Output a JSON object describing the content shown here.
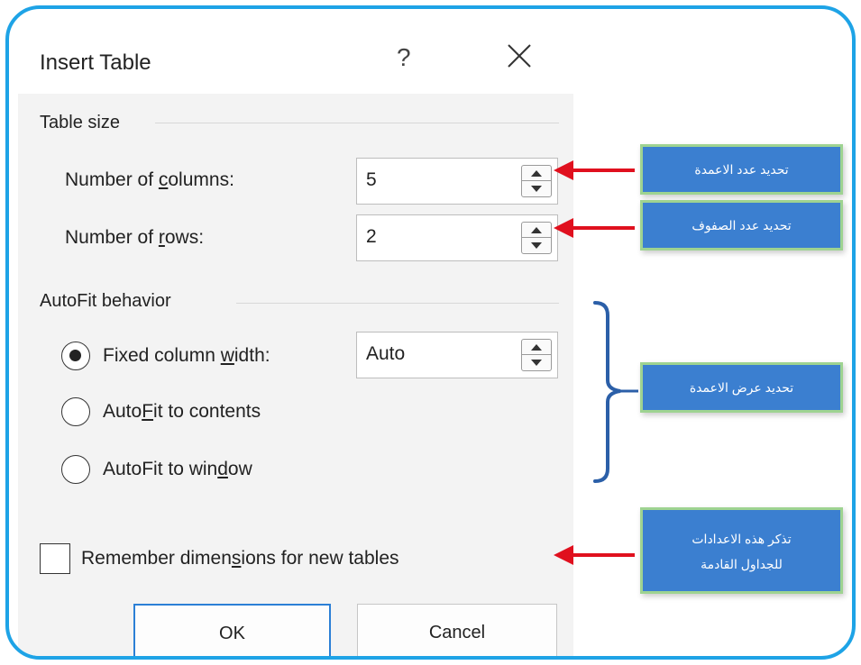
{
  "dialog": {
    "title": "Insert Table",
    "help_glyph": "?",
    "close_icon": "close-icon"
  },
  "table_size": {
    "heading": "Table size",
    "columns": {
      "label_pre": "Number of ",
      "label_u": "c",
      "label_post": "olumns:",
      "value": "5"
    },
    "rows": {
      "label_pre": "Number of ",
      "label_u": "r",
      "label_post": "ows:",
      "value": "2"
    }
  },
  "autofit": {
    "heading": "AutoFit behavior",
    "fixed": {
      "label_pre": "Fixed column ",
      "label_u": "w",
      "label_post": "idth:",
      "value": "Auto",
      "selected": true
    },
    "contents": {
      "label_pre": "Auto",
      "label_u": "F",
      "label_post": "it to contents",
      "selected": false
    },
    "window": {
      "label_pre": "AutoFit to win",
      "label_u": "d",
      "label_post": "ow",
      "selected": false
    }
  },
  "remember": {
    "label_pre": "Remember dimen",
    "label_u": "s",
    "label_post": "ions for new tables",
    "checked": false
  },
  "buttons": {
    "ok": "OK",
    "cancel": "Cancel"
  },
  "annotations": {
    "columns": "تحديد عدد الاعمدة",
    "rows": "تحديد عدد الصفوف",
    "width": "تحديد عرض الاعمدة",
    "remember_line1": "تذكر هذه الاعدادات",
    "remember_line2": "للجداول القادمة"
  },
  "colors": {
    "frame": "#1ea3e6",
    "arrow": "#e0101e",
    "callout_fill": "#3b7fd0",
    "callout_border": "#9ed391",
    "brace": "#2b5fa8"
  }
}
